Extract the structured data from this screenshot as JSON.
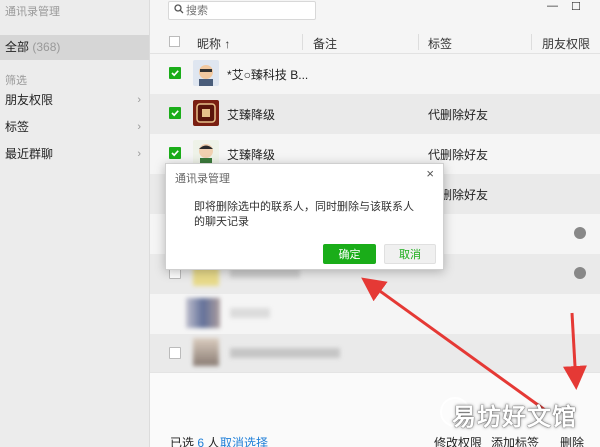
{
  "app": {
    "title": "通讯录管理"
  },
  "sidebar": {
    "all_label": "全部",
    "all_count": "(368)",
    "filter_title": "筛选",
    "items": [
      {
        "label": "朋友权限",
        "chevron": "›"
      },
      {
        "label": "标签",
        "chevron": "›"
      },
      {
        "label": "最近群聊",
        "chevron": "›"
      }
    ]
  },
  "search": {
    "placeholder": "搜索",
    "icon": "search-icon"
  },
  "window_controls": {
    "minimize": "—",
    "maximize": "☐"
  },
  "table": {
    "headers": {
      "nickname": "昵称 ↑",
      "remark": "备注",
      "tags": "标签",
      "permission": "朋友权限"
    },
    "rows": [
      {
        "name": "*艾○臻科技 B...",
        "tag": "",
        "checked": true
      },
      {
        "name": "艾臻降级",
        "tag": "代删除好友",
        "checked": true
      },
      {
        "name": "艾臻降级",
        "tag": "代删除好友",
        "checked": true
      },
      {
        "name": "",
        "tag": "代删除好友",
        "checked": true
      }
    ]
  },
  "dialog": {
    "title": "通讯录管理",
    "close": "×",
    "message": "即将删除选中的联系人，同时删除与该联系人的聊天记录",
    "ok_label": "确定",
    "cancel_label": "取消"
  },
  "bottom": {
    "selected_prefix": "已选",
    "selected_count": "6",
    "selected_suffix": "人",
    "deselect": "取消选择",
    "modify_permission": "修改权限",
    "add_tag": "添加标签",
    "delete": "删除"
  },
  "watermark": {
    "text": "易坊好文馆"
  },
  "colors": {
    "accent": "#1aad19",
    "link": "#1f7fd8",
    "arrow": "#e53935"
  }
}
